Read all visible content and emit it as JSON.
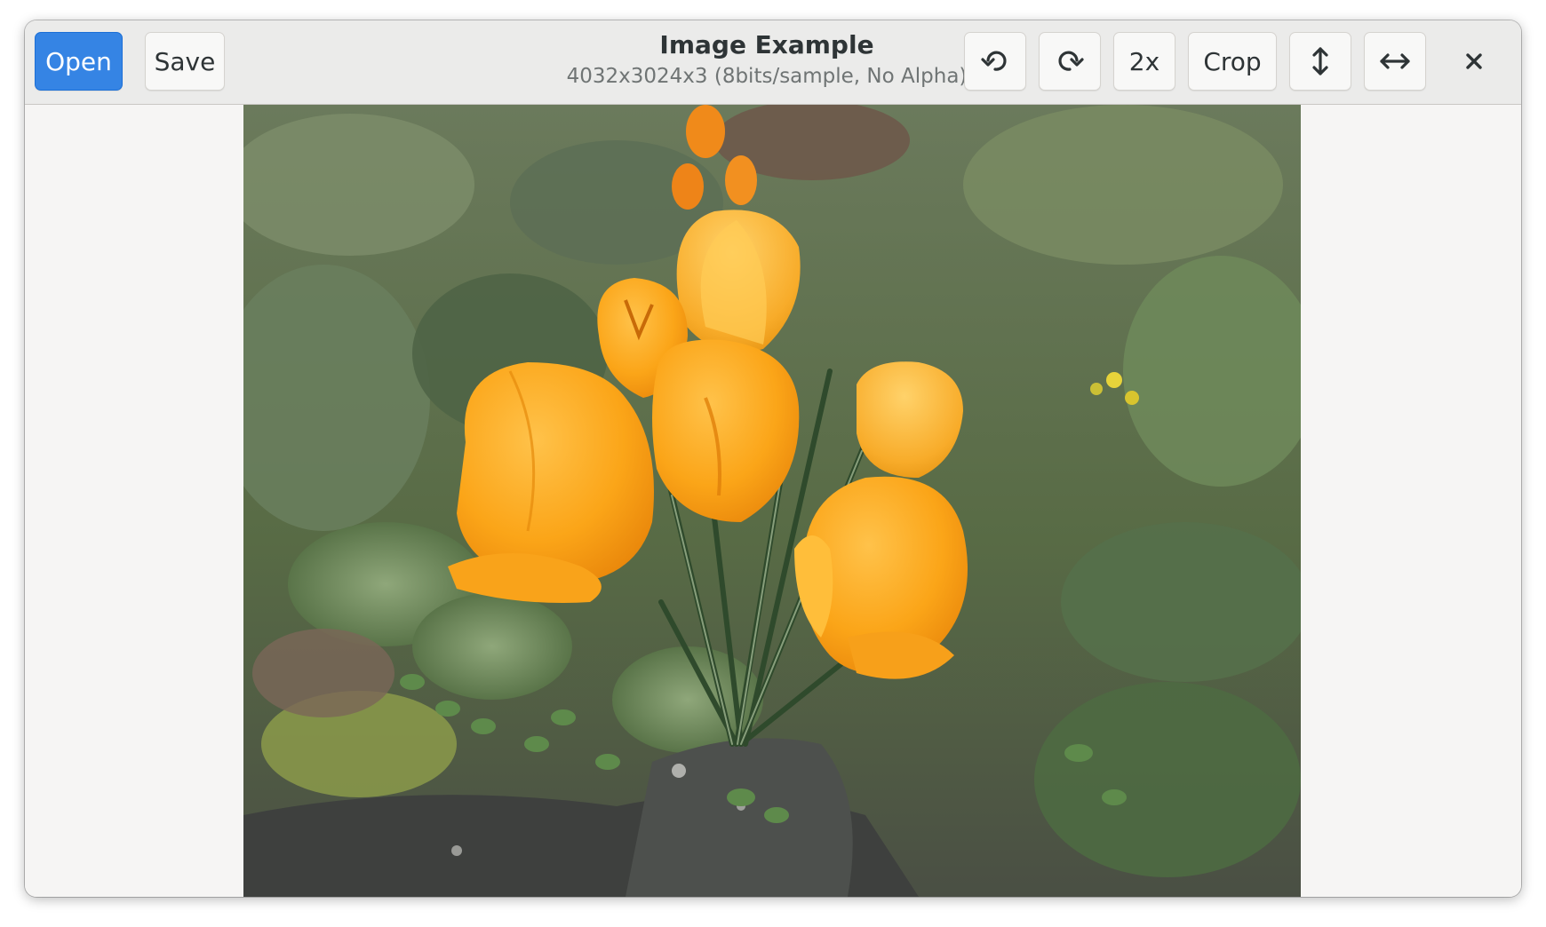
{
  "window": {
    "title": "Image Example",
    "subtitle": "4032x3024x3 (8bits/sample, No Alpha)"
  },
  "toolbar": {
    "open_label": "Open",
    "save_label": "Save",
    "zoom_label": "2x",
    "crop_label": "Crop",
    "rotate_left_icon": "rotate-counterclockwise-icon",
    "rotate_right_icon": "rotate-clockwise-icon",
    "flip_vertical_icon": "vertical-arrows-icon",
    "flip_horizontal_icon": "horizontal-arrows-icon",
    "close_icon": "close-icon"
  },
  "colors": {
    "accent": "#3584e4",
    "headerbar": "#ebebea",
    "background": "#f6f5f4"
  }
}
